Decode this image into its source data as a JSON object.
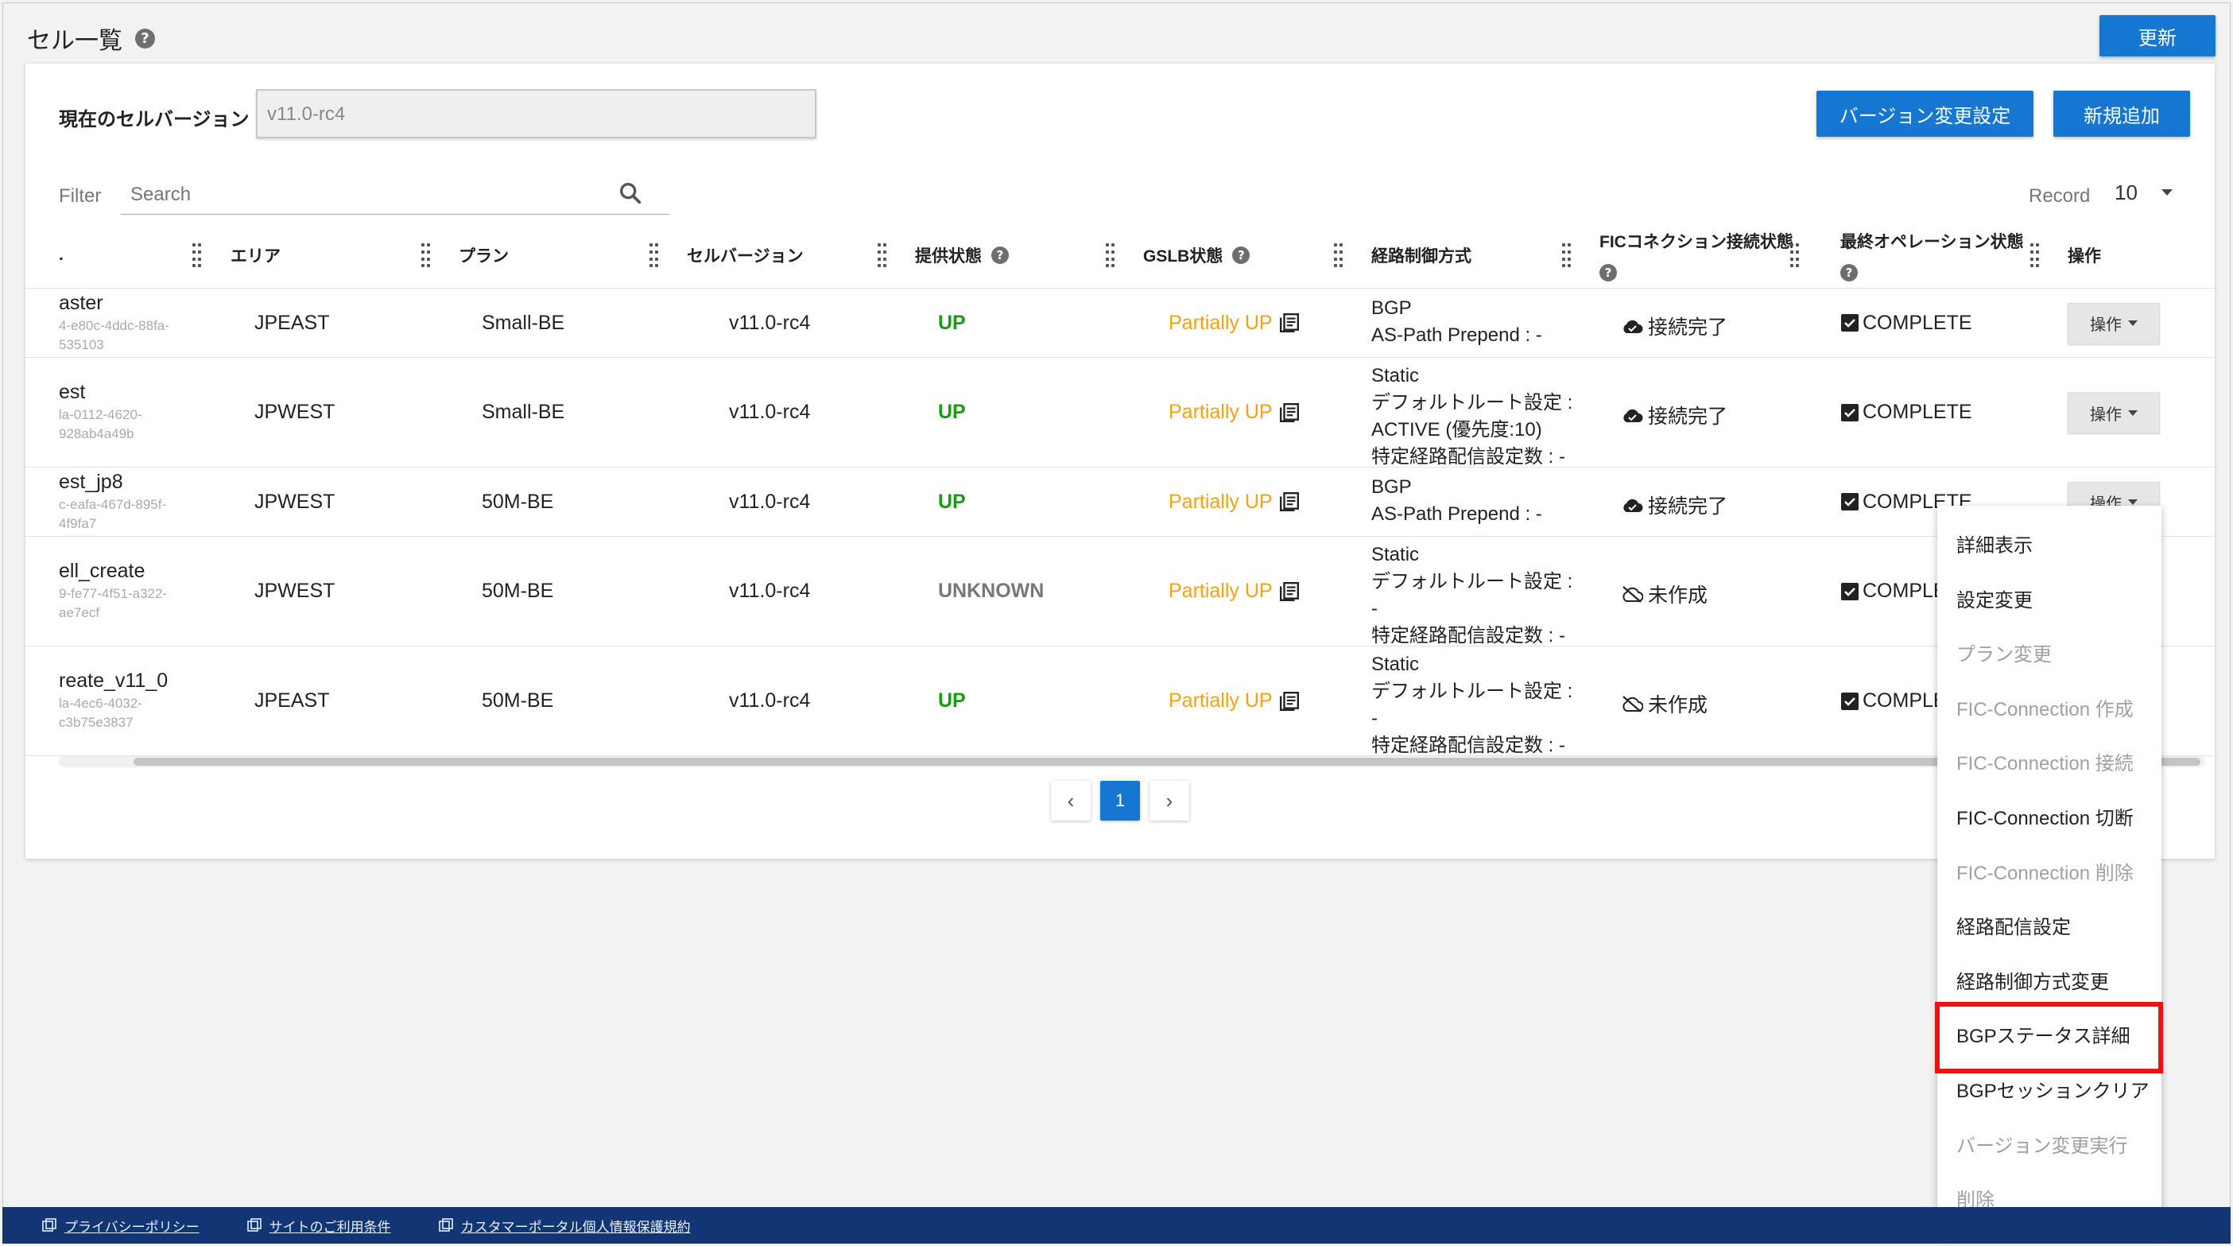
{
  "page": {
    "title": "セル一覧"
  },
  "header": {
    "refresh_label": "更新"
  },
  "version": {
    "label": "現在のセルバージョン",
    "value": "v11.0-rc4"
  },
  "actions": {
    "version_change_label": "バージョン変更設定",
    "add_label": "新規追加"
  },
  "filter": {
    "label": "Filter",
    "placeholder": "Search"
  },
  "record": {
    "label": "Record",
    "value": "10"
  },
  "columns": {
    "name": "",
    "area": "エリア",
    "plan": "プラン",
    "version": "セルバージョン",
    "status": "提供状態",
    "gslb": "GSLB状態",
    "route": "経路制御方式",
    "fic": "FICコネクション接続状態",
    "lastop": "最終オペレーション状態",
    "ops": "操作"
  },
  "rows": [
    {
      "name": "aster",
      "id1": "4-e80c-4ddc-88fa-",
      "id2": "535103",
      "area": "JPEAST",
      "plan": "Small-BE",
      "version": "v11.0-rc4",
      "status": "UP",
      "gslb": "Partially UP",
      "route1": "BGP",
      "route2": "AS-Path Prepend : -",
      "route3": "",
      "route4": "",
      "fic": "接続完了",
      "lastop": "COMPLETE",
      "op": "操作"
    },
    {
      "name": "est",
      "id1": "la-0112-4620-",
      "id2": "928ab4a49b",
      "area": "JPWEST",
      "plan": "Small-BE",
      "version": "v11.0-rc4",
      "status": "UP",
      "gslb": "Partially UP",
      "route1": "Static",
      "route2": "デフォルトルート設定 :",
      "route3": "ACTIVE (優先度:10)",
      "route4": "特定経路配信設定数 : -",
      "fic": "接続完了",
      "lastop": "COMPLETE",
      "op": "操作"
    },
    {
      "name": "est_jp8",
      "id1": "c-eafa-467d-895f-",
      "id2": "4f9fa7",
      "area": "JPWEST",
      "plan": "50M-BE",
      "version": "v11.0-rc4",
      "status": "UP",
      "gslb": "Partially UP",
      "route1": "BGP",
      "route2": "AS-Path Prepend : -",
      "route3": "",
      "route4": "",
      "fic": "接続完了",
      "lastop": "COMPLETE",
      "op": "操作"
    },
    {
      "name": "ell_create",
      "id1": "9-fe77-4f51-a322-",
      "id2": "ae7ecf",
      "area": "JPWEST",
      "plan": "50M-BE",
      "version": "v11.0-rc4",
      "status": "UNKNOWN",
      "gslb": "Partially UP",
      "route1": "Static",
      "route2": "デフォルトルート設定 :",
      "route3": "-",
      "route4": "特定経路配信設定数 : -",
      "fic": "未作成",
      "lastop": "COMPLE",
      "op": ""
    },
    {
      "name": "reate_v11_0",
      "id1": "la-4ec6-4032-",
      "id2": "c3b75e3837",
      "area": "JPEAST",
      "plan": "50M-BE",
      "version": "v11.0-rc4",
      "status": "UP",
      "gslb": "Partially UP",
      "route1": "Static",
      "route2": "デフォルトルート設定 :",
      "route3": "-",
      "route4": "特定経路配信設定数 : -",
      "fic": "未作成",
      "lastop": "COMPLE",
      "op": ""
    }
  ],
  "pagination": {
    "prev": "‹",
    "current": "1",
    "next": "›"
  },
  "menu": {
    "items": [
      {
        "label": "詳細表示",
        "enabled": true
      },
      {
        "label": "設定変更",
        "enabled": true
      },
      {
        "label": "プラン変更",
        "enabled": false
      },
      {
        "label": "FIC-Connection 作成",
        "enabled": false
      },
      {
        "label": "FIC-Connection 接続",
        "enabled": false
      },
      {
        "label": "FIC-Connection 切断",
        "enabled": true
      },
      {
        "label": "FIC-Connection 削除",
        "enabled": false
      },
      {
        "label": "経路配信設定",
        "enabled": true
      },
      {
        "label": "経路制御方式変更",
        "enabled": true
      },
      {
        "label": "BGPステータス詳細",
        "enabled": true
      },
      {
        "label": "BGPセッションクリア",
        "enabled": true
      },
      {
        "label": "バージョン変更実行",
        "enabled": false
      },
      {
        "label": "削除",
        "enabled": false
      }
    ]
  },
  "footer": {
    "links": [
      "プライバシーポリシー",
      "サイトのご利用条件",
      "カスタマーポータル個人情報保護規約"
    ]
  },
  "colors": {
    "primary": "#1677d2",
    "up": "#1a9a14",
    "partial": "#f6a210",
    "footer": "#123573",
    "highlight": "#ee1111"
  }
}
